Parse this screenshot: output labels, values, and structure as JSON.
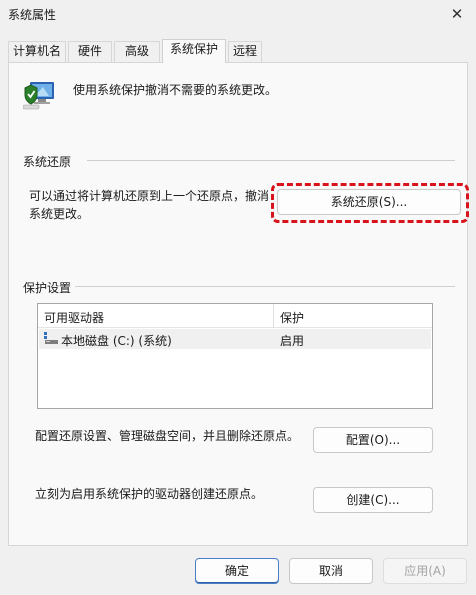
{
  "window": {
    "title": "系统属性",
    "close_glyph": "✕"
  },
  "tabs": [
    {
      "label": "计算机名"
    },
    {
      "label": "硬件"
    },
    {
      "label": "高级"
    },
    {
      "label": "系统保护",
      "active": true
    },
    {
      "label": "远程"
    }
  ],
  "intro": {
    "text": "使用系统保护撤消不需要的系统更改。",
    "icon": "system-protection-shield-icon"
  },
  "restore": {
    "title": "系统还原",
    "desc_line1": "可以通过将计算机还原到上一个还原点，撤消",
    "desc_line2": "系统更改。",
    "button_label": "系统还原(S)...",
    "highlight_color": "#d8141a"
  },
  "protection": {
    "title": "保护设置",
    "columns": [
      "可用驱动器",
      "保护"
    ],
    "rows": [
      {
        "drive": "本地磁盘 (C:) (系统)",
        "protection": "启用",
        "icon": "drive-icon"
      }
    ],
    "configure_text": "配置还原设置、管理磁盘空间，并且删除还原点。",
    "configure_button": "配置(O)...",
    "create_text": "立刻为启用系统保护的驱动器创建还原点。",
    "create_button": "创建(C)..."
  },
  "footer": {
    "ok": "确定",
    "cancel": "取消",
    "apply": "应用(A)"
  },
  "colors": {
    "accent": "#4a7fc7",
    "background": "#f0f0f0",
    "panel": "#f9f9f9"
  }
}
